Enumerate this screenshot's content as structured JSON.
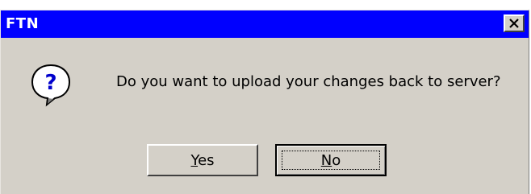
{
  "window": {
    "title": "FTN",
    "titlebar_color": "#0000ff",
    "background_color": "#d4d0c8"
  },
  "dialog": {
    "icon": "question-icon",
    "message": "Do you want to upload your changes back to server?"
  },
  "buttons": {
    "yes": {
      "mnemonic": "Y",
      "rest": "es"
    },
    "no": {
      "mnemonic": "N",
      "rest": "o",
      "focused": true
    }
  }
}
